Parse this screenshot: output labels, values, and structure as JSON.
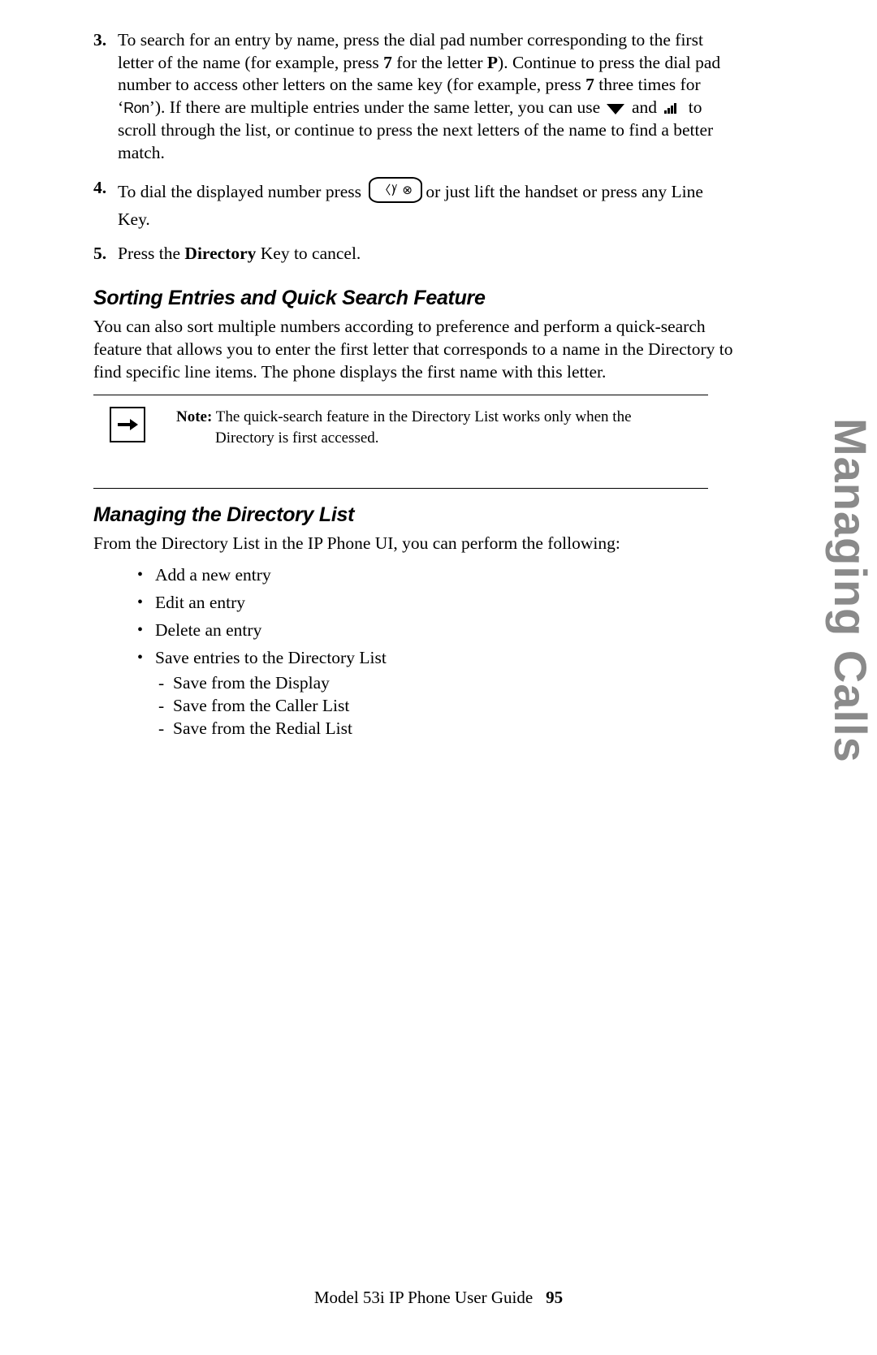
{
  "steps": [
    {
      "num": "3.",
      "segments": [
        {
          "t": "text",
          "v": "To search for an entry by name, press the dial pad number corresponding to the first letter of the name (for example, press "
        },
        {
          "t": "bold",
          "v": "7"
        },
        {
          "t": "text",
          "v": " for the letter "
        },
        {
          "t": "bold",
          "v": "P"
        },
        {
          "t": "text",
          "v": "). Continue to press the dial pad number to access other letters on the same key (for example, press "
        },
        {
          "t": "bold",
          "v": "7"
        },
        {
          "t": "text",
          "v": " three times for ‘"
        },
        {
          "t": "mono",
          "v": "Ron"
        },
        {
          "t": "text",
          "v": "’). If there are multiple entries under the same letter, you can use "
        },
        {
          "t": "icon",
          "v": "down-arrow-icon"
        },
        {
          "t": "text",
          "v": " and "
        },
        {
          "t": "icon",
          "v": "up-arrow-icon"
        },
        {
          "t": "text",
          "v": " to scroll through the list, or continue to press the next letters of the name to find a better match."
        }
      ]
    },
    {
      "num": "4.",
      "segments": [
        {
          "t": "text",
          "v": "To dial the displayed number press "
        },
        {
          "t": "icon",
          "v": "speaker-headset-key-icon"
        },
        {
          "t": "text",
          "v": "or just lift the handset or press any Line Key."
        }
      ]
    },
    {
      "num": "5.",
      "segments": [
        {
          "t": "text",
          "v": "Press the "
        },
        {
          "t": "bold",
          "v": "Directory"
        },
        {
          "t": "text",
          "v": " Key to cancel."
        }
      ]
    }
  ],
  "sorting": {
    "heading": "Sorting Entries and Quick Search Feature",
    "paragraph": "You can also sort multiple numbers according to preference and perform a quick-search feature that allows you to enter the first letter that corresponds to a name in the Directory to find specific line items. The phone displays the first name with this letter."
  },
  "note": {
    "label": "Note:",
    "line1": "The quick-search feature in the Directory List works only when the",
    "line2": "Directory is first accessed.",
    "icon": "arrow-right-note-icon"
  },
  "managing": {
    "heading": "Managing the Directory List",
    "intro": "From the Directory List in the IP Phone UI, you can perform the following:",
    "bullets": [
      "Add a new entry",
      "Edit an entry",
      "Delete an entry",
      "Save entries to the Directory List"
    ],
    "sub_items": [
      "Save from the Display",
      "Save from the Caller List",
      "Save from the Redial List"
    ]
  },
  "side_tab": "Managing Calls",
  "footer": {
    "guide_title": "Model 53i IP Phone User Guide",
    "page_number": "95"
  },
  "colors": {
    "text": "#000000",
    "side_tab": "#8a8a8a",
    "page_bg": "#ffffff"
  },
  "icon_glyphs": {
    "down_arrow": "▼",
    "up_arrow": "bars-ascending",
    "speaker_key": "speaker / headset",
    "note_arrow": "➔"
  }
}
